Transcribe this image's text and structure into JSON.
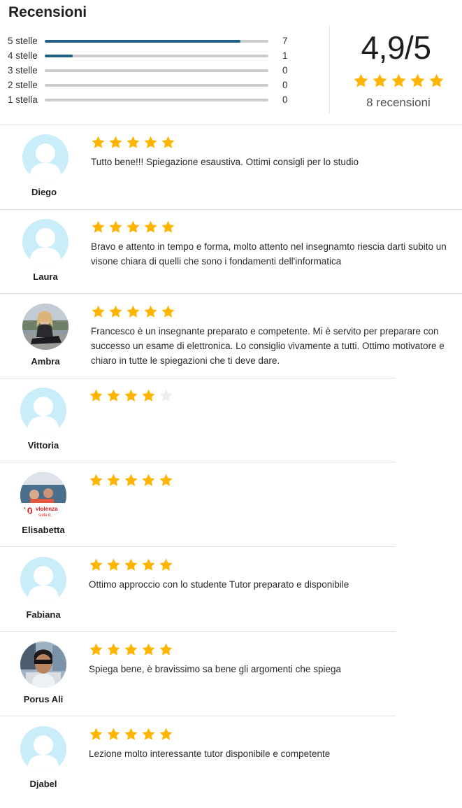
{
  "header": {
    "title": "Recensioni"
  },
  "distribution": [
    {
      "label": "5 stelle",
      "count": "7",
      "fraction": 0.875
    },
    {
      "label": "4 stelle",
      "count": "1",
      "fraction": 0.125
    },
    {
      "label": "3 stelle",
      "count": "0",
      "fraction": 0
    },
    {
      "label": "2 stelle",
      "count": "0",
      "fraction": 0
    },
    {
      "label": "1 stella",
      "count": "0",
      "fraction": 0
    }
  ],
  "summary": {
    "score": "4,9/5",
    "stars": 5,
    "count_label": "8 recensioni"
  },
  "colors": {
    "star": "#ffb400",
    "star_empty": "#eeeeee",
    "bar_fill": "#1e5f82",
    "bar_track": "#cccccc",
    "avatar_placeholder": "#c9edf9"
  },
  "reviews": [
    {
      "name": "Diego",
      "rating": 5,
      "text": "Tutto bene!!! Spiegazione esaustiva. Ottimi consigli per lo studio",
      "avatar": "placeholder"
    },
    {
      "name": "Laura",
      "rating": 5,
      "text": "Bravo e attento in tempo e forma, molto attento nel insegnamto riescia darti subito un visone chiara di quelli che sono i fondamenti dell'informatica",
      "avatar": "placeholder"
    },
    {
      "name": "Ambra",
      "rating": 5,
      "text": "Francesco è un insegnante preparato e competente. Mi è servito per preparare con successo un esame di elettronica. Lo consiglio vivamente a tutti. Ottimo motivatore e chiaro in tutte le spiegazioni che ti deve dare.",
      "avatar": "photo-ambra"
    },
    {
      "name": "Vittoria",
      "rating": 4,
      "text": "",
      "avatar": "placeholder"
    },
    {
      "name": "Elisabetta",
      "rating": 5,
      "text": "",
      "avatar": "photo-elisabetta",
      "avatar_caption": "violenza"
    },
    {
      "name": "Fabiana",
      "rating": 5,
      "text": "Ottimo approccio con lo studente Tutor preparato e disponibile",
      "avatar": "placeholder"
    },
    {
      "name": "Porus Ali",
      "rating": 5,
      "text": "Spiega bene, è bravissimo sa bene gli argomenti che spiega",
      "avatar": "photo-porus"
    },
    {
      "name": "Djabel",
      "rating": 5,
      "text": "Lezione molto interessante tutor disponibile e competente",
      "avatar": "placeholder"
    }
  ]
}
